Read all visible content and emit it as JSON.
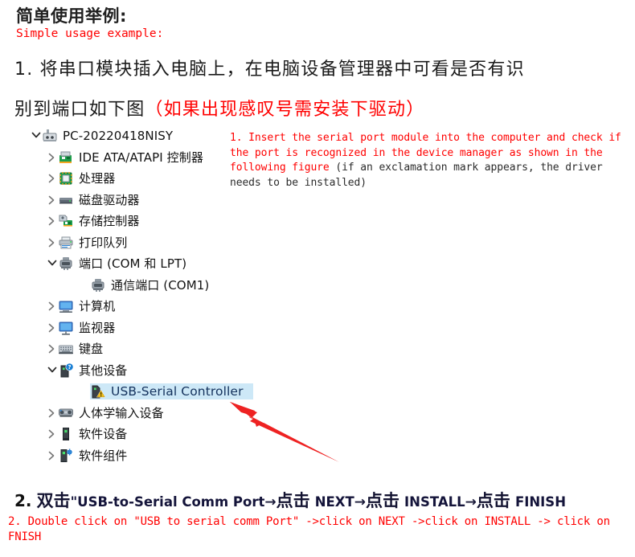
{
  "document": {
    "cn_title": "简单使用举例:",
    "en_title": "Simple usage example:",
    "step1_line1": "1. 将串口模块插入电脑上，在电脑设备管理器中可看是否有识",
    "step1_line2_black": "别到端口如下图",
    "step1_line2_red": "（如果出现感叹号需安装下驱动）",
    "note_red": "1. Insert the serial port module into the computer and check if the port is recognized in the device manager as shown in the following figure ",
    "note_black": "(if an exclamation mark appears, the driver needs to be installed)",
    "step2_cn_num": "2.",
    "step2_cn_p1": "双击",
    "step2_cn_quote": "\"",
    "step2_cn_p2": "USB-to-Serial Comm Port",
    "step2_arrow": "→",
    "step2_cn_p3": "点击",
    "step2_next": "NEXT",
    "step2_cn_p4": "点击",
    "step2_install": "INSTALL",
    "step2_cn_p5": "点击",
    "step2_finish": "FINISH",
    "step2_en": "2. Double click on \"USB to serial comm Port\" ->click on NEXT ->click on INSTALL -> click on FNISH"
  },
  "colors": {
    "red": "#ff0000",
    "selection_bg": "#cde8f7",
    "selection_text": "#13315c",
    "chevron": "#767676",
    "arrow_red": "#ee2222"
  },
  "device_tree": {
    "rows": [
      {
        "label": "PC-20220418NISY",
        "level": 0,
        "state": "expanded",
        "icon": "computer-root-icon"
      },
      {
        "label": "IDE ATA/ATAPI 控制器",
        "level": 1,
        "state": "collapsed",
        "icon": "ide-controller-icon"
      },
      {
        "label": "处理器",
        "level": 1,
        "state": "collapsed",
        "icon": "processor-icon"
      },
      {
        "label": "磁盘驱动器",
        "level": 1,
        "state": "collapsed",
        "icon": "disk-drive-icon"
      },
      {
        "label": "存储控制器",
        "level": 1,
        "state": "collapsed",
        "icon": "storage-controller-icon"
      },
      {
        "label": "打印队列",
        "level": 1,
        "state": "collapsed",
        "icon": "print-queue-icon"
      },
      {
        "label": "端口 (COM 和 LPT)",
        "level": 1,
        "state": "expanded",
        "icon": "port-icon"
      },
      {
        "label": "通信端口 (COM1)",
        "level": 2,
        "state": "leaf",
        "icon": "port-icon"
      },
      {
        "label": "计算机",
        "level": 1,
        "state": "collapsed",
        "icon": "computer-icon"
      },
      {
        "label": "监视器",
        "level": 1,
        "state": "collapsed",
        "icon": "monitor-icon"
      },
      {
        "label": "键盘",
        "level": 1,
        "state": "collapsed",
        "icon": "keyboard-icon"
      },
      {
        "label": "其他设备",
        "level": 1,
        "state": "expanded",
        "icon": "other-device-question-icon"
      },
      {
        "label": "USB-Serial Controller",
        "level": 2,
        "state": "leaf",
        "icon": "unknown-device-warning-icon",
        "selected": true
      },
      {
        "label": "人体学输入设备",
        "level": 1,
        "state": "collapsed",
        "icon": "hid-icon"
      },
      {
        "label": "软件设备",
        "level": 1,
        "state": "collapsed",
        "icon": "software-device-icon"
      },
      {
        "label": "软件组件",
        "level": 1,
        "state": "collapsed",
        "icon": "software-component-icon"
      }
    ]
  },
  "annotation": {
    "arrow_name": "red-pointer-arrow",
    "points_to": "USB-Serial Controller"
  }
}
